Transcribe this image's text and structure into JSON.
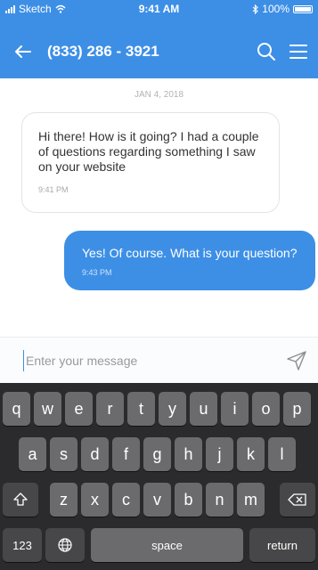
{
  "status_bar": {
    "carrier": "Sketch",
    "time": "9:41 AM",
    "battery": "100%"
  },
  "header": {
    "title": "(833) 286 - 3921"
  },
  "conversation": {
    "date": "JAN 4, 2018",
    "messages": [
      {
        "direction": "incoming",
        "text": "Hi there! How is it going? I had a couple of questions regarding something I saw on your website",
        "time": "9:41 PM"
      },
      {
        "direction": "outgoing",
        "text": "Yes! Of course. What is your question?",
        "time": "9:43 PM"
      }
    ]
  },
  "composer": {
    "placeholder": "Enter your message",
    "value": ""
  },
  "keyboard": {
    "row1": [
      "q",
      "w",
      "e",
      "r",
      "t",
      "y",
      "u",
      "i",
      "o",
      "p"
    ],
    "row2": [
      "a",
      "s",
      "d",
      "f",
      "g",
      "h",
      "j",
      "k",
      "l"
    ],
    "row3": [
      "z",
      "x",
      "c",
      "v",
      "b",
      "n",
      "m"
    ],
    "numbers_label": "123",
    "space_label": "space",
    "return_label": "return"
  },
  "colors": {
    "accent": "#3d8fe6",
    "keyboard_bg": "#2b2b2d",
    "key": "#6b6b6e"
  }
}
